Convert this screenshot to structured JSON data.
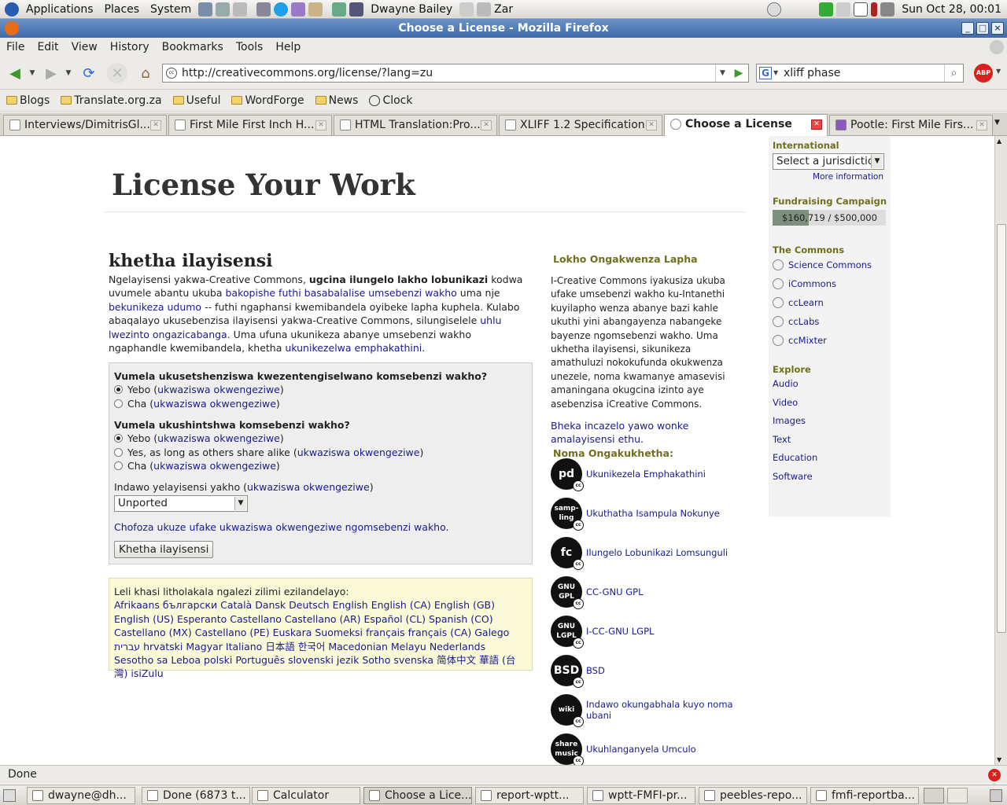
{
  "panel": {
    "menus": [
      "Applications",
      "Places",
      "System"
    ],
    "user": "Dwayne Bailey",
    "weather": "Zar",
    "clock": "Sun Oct 28, 00:01"
  },
  "window": {
    "title": "Choose a License - Mozilla Firefox"
  },
  "menubar": [
    "File",
    "Edit",
    "View",
    "History",
    "Bookmarks",
    "Tools",
    "Help"
  ],
  "nav": {
    "url": "http://creativecommons.org/license/?lang=zu",
    "search": "xliff phase",
    "abp": "ABP"
  },
  "bookmarks": [
    "Blogs",
    "Translate.org.za",
    "Useful",
    "WordForge",
    "News",
    "Clock"
  ],
  "tabs": [
    {
      "label": "Interviews/DimitrisGl..."
    },
    {
      "label": "First Mile First Inch H..."
    },
    {
      "label": "HTML Translation:Pro..."
    },
    {
      "label": "XLIFF 1.2 Specification"
    },
    {
      "label": "Choose a License"
    },
    {
      "label": "Pootle: First Mile Firs..."
    }
  ],
  "page": {
    "heading": "License Your Work",
    "subheading": "khetha ilayisensi",
    "intro": {
      "p1": "Ngelayisensi yakwa-Creative Commons, ",
      "bold": "ugcina ilungelo lakho lobunikazi",
      "p2": " kodwa uvumele abantu ukuba ",
      "l1": "bakopishe futhi basabalalise umsebenzi wakho",
      "p3": " uma nje ",
      "l2": "bekunikeza udumo",
      "p4": " -- futhi ngaphansi kwemibandela oyibeke lapha kuphela. Kulabo abaqalayo ukusebenzisa ilayisensi yakwa-Creative Commons, silungiselele ",
      "l3": "uhlu lwezinto ongazicabanga",
      "p5": ". Uma ufuna ukunikeza abanye umsebenzi wakho ngaphandle kwemibandela, khetha ",
      "l4": "ukunikezelwa emphakathini",
      "p6": "."
    },
    "form": {
      "q1": "Vumela ukusetshenziswa kwezentengiselwano komsebenzi wakho?",
      "q1_opts": [
        "Yebo (",
        "Cha ("
      ],
      "q2": "Vumela ukushintshwa komsebenzi wakho?",
      "q2_opts": [
        "Yebo (",
        "Yes, as long as others share alike (",
        "Cha ("
      ],
      "more": "ukwaziswa okwengeziwe",
      "close": ")",
      "juris_label": "Indawo yelayisensi yakho (",
      "juris_value": "Unported",
      "choose_link": "Chofoza ukuze ufake ukwaziswa okwengeziwe ngomsebenzi wakho.",
      "submit": "Khetha ilayisensi"
    },
    "languages": {
      "label": "Leli khasi litholakala ngalezi zilimi ezilandelayo:",
      "list": [
        "Afrikaans",
        "български",
        "Català",
        "Dansk",
        "Deutsch",
        "English",
        "English (CA)",
        "English (GB)",
        "English (US)",
        "Esperanto",
        "Castellano",
        "Castellano (AR)",
        "Español (CL)",
        "Spanish (CO)",
        "Castellano (MX)",
        "Castellano (PE)",
        "Euskara",
        "Suomeksi",
        "français",
        "français (CA)",
        "Galego",
        "עברית",
        "hrvatski",
        "Magyar",
        "Italiano",
        "日本語",
        "한국어",
        "Macedonian",
        "Melayu",
        "Nederlands",
        "Sesotho sa Leboa",
        "polski",
        "Português",
        "slovenski jezik",
        "Sotho",
        "svenska",
        "简体中文",
        "華語 (台灣)",
        "isiZulu"
      ]
    },
    "mid": {
      "head1": "Lokho Ongakwenza Lapha",
      "text": "I-Creative Commons iyakusiza ukuba ufake umsebenzi wakho ku-Intanethi kuyilapho wenza abanye bazi kahle ukuthi yini abangayenza nabangeke bayenze ngomsebenzi wakho. Uma ukhetha ilayisensi, sikunikeza amathuluzi nokokufunda okukwenza unezele, noma kwamanye amasevisi amaningana okugcina izinto aye asebenzisa iCreative Commons.",
      "link": "Bheka incazelo yawo wonke amalayisensi ethu.",
      "head2": "Noma Ongakukhetha:",
      "licenses": [
        {
          "badge": "pd",
          "label": "Ukunikezela Emphakathini"
        },
        {
          "badge": "samp-ling",
          "label": "Ukuthatha Isampula Nokunye"
        },
        {
          "badge": "fc",
          "label": "Ilungelo Lobunikazi Lomsunguli"
        },
        {
          "badge": "GNU GPL",
          "label": "CC-GNU GPL"
        },
        {
          "badge": "GNU LGPL",
          "label": "I-CC-GNU LGPL"
        },
        {
          "badge": "BSD",
          "label": "BSD"
        },
        {
          "badge": "wiki",
          "label": "Indawo okungabhala kuyo noma ubani"
        },
        {
          "badge": "share music",
          "label": "Ukuhlanganyela Umculo"
        }
      ]
    },
    "side": {
      "intl": "International",
      "juris_select": "Select a jurisdiction",
      "more_info": "More information",
      "fund_head": "Fundraising Campaign",
      "fund_text": "$160,719 / $500,000",
      "fund_progress": 0.32,
      "commons_head": "The Commons",
      "commons": [
        "Science Commons",
        "iCommons",
        "ccLearn",
        "ccLabs",
        "ccMixter"
      ],
      "explore_head": "Explore",
      "explore": [
        "Audio",
        "Video",
        "Images",
        "Text",
        "Education",
        "Software"
      ]
    }
  },
  "status": "Done",
  "taskbar": [
    "dwayne@dh...",
    "Done (6873 t...",
    "Calculator",
    "Choose a Lice...",
    "report-wptt...",
    "wptt-FMFI-pr...",
    "peebles-repo...",
    "fmfi-reportba..."
  ]
}
